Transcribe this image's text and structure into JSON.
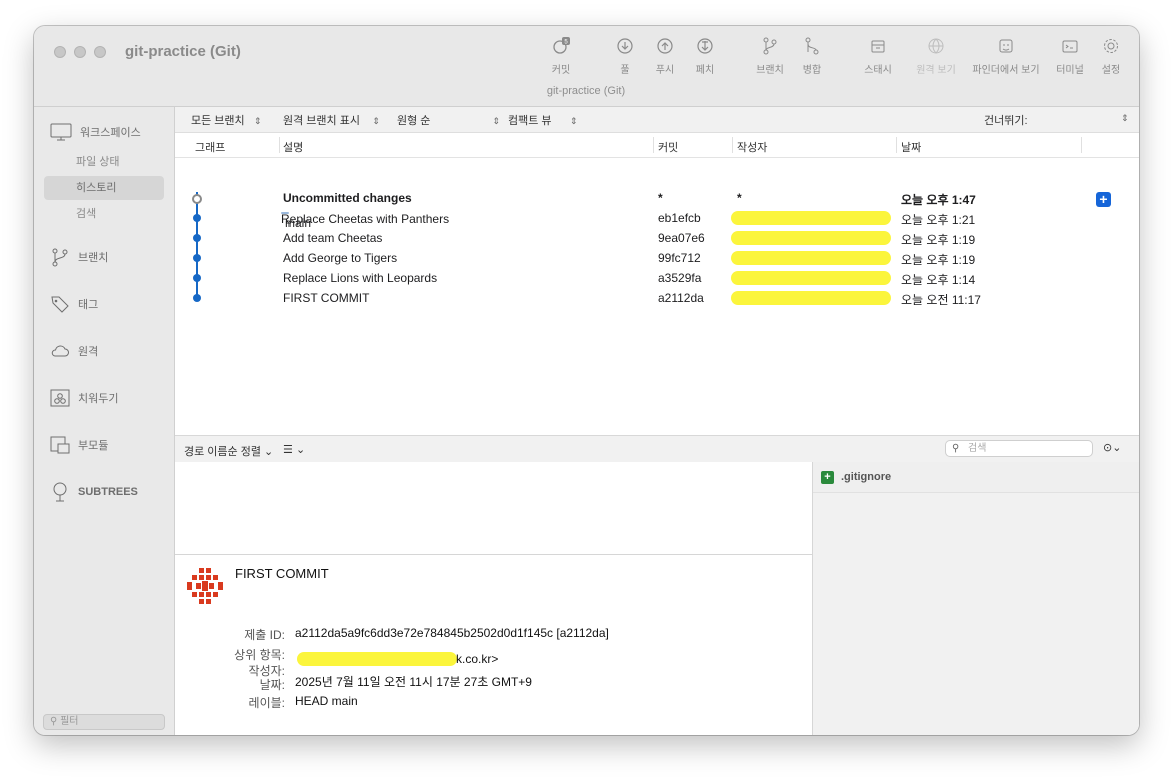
{
  "window": {
    "title": "git-practice (Git)",
    "subtitle": "git-practice (Git)"
  },
  "toolbar": [
    {
      "label": "커밋",
      "icon": "commit-icon",
      "badge": "5"
    },
    {
      "label": "풀",
      "icon": "pull-icon"
    },
    {
      "label": "푸시",
      "icon": "push-icon"
    },
    {
      "label": "페치",
      "icon": "fetch-icon"
    },
    {
      "label": "브랜치",
      "icon": "branch-icon"
    },
    {
      "label": "병합",
      "icon": "merge-icon"
    },
    {
      "label": "스태시",
      "icon": "stash-icon"
    },
    {
      "label": "원격 보기",
      "icon": "remote-view-icon",
      "disabled": true
    },
    {
      "label": "파인더에서 보기",
      "icon": "finder-icon"
    },
    {
      "label": "터미널",
      "icon": "terminal-icon"
    },
    {
      "label": "설정",
      "icon": "settings-icon"
    }
  ],
  "sidebar": {
    "workspace": "워크스페이스",
    "file_status": "파일 상태",
    "history": "히스토리",
    "search": "검색",
    "branches": "브랜치",
    "tags": "태그",
    "remotes": "원격",
    "stashes": "치워두기",
    "submodules": "부모듈",
    "subtrees": "SUBTREES",
    "filter_placeholder": "필터"
  },
  "filterbar": {
    "branches": "모든 브랜치",
    "remote": "원격 브랜치 표시",
    "order": "원형 순",
    "view": "컴팩트 뷰",
    "skip": "건너뛰기:"
  },
  "columns": {
    "graph": "그래프",
    "description": "설명",
    "commit": "커밋",
    "author": "작성자",
    "date": "날짜"
  },
  "commits": [
    {
      "description": "Uncommitted changes",
      "hash": "*",
      "author": "*",
      "date": "오늘 오후 1:47",
      "bold": true
    },
    {
      "branch": "main",
      "description": "Replace Cheetas with Panthers",
      "hash": "eb1efcb",
      "date": "오늘 오후 1:21"
    },
    {
      "description": "Add team Cheetas",
      "hash": "9ea07e6",
      "date": "오늘 오후 1:19"
    },
    {
      "description": "Add George to Tigers",
      "hash": "99fc712",
      "date": "오늘 오후 1:19"
    },
    {
      "description": "Replace Lions with Leopards",
      "hash": "a3529fa",
      "date": "오늘 오후 1:14"
    },
    {
      "description": "FIRST COMMIT",
      "hash": "a2112da",
      "date": "오늘 오전 11:17"
    }
  ],
  "midbar": {
    "sort": "경로 이름순 정렬",
    "search_placeholder": "검색"
  },
  "files": [
    {
      "name": ".gitignore",
      "status": "added"
    }
  ],
  "details": {
    "title": "FIRST COMMIT",
    "commit_id_label": "제출 ID:",
    "commit_id": "a2112da5a9fc6dd3e72e784845b2502d0d1f145c [a2112da]",
    "parent_label": "상위 항목:",
    "parent_value": "k.co.kr>",
    "author_label": "작성자:",
    "date_label": "날짜:",
    "date": "2025년 7월 11일 오전 11시 17분 27초 GMT+9",
    "labels_label": "레이블:",
    "labels": "HEAD main"
  },
  "colors": {
    "accent": "#1668c6",
    "redaction": "#fbf53c",
    "add": "#2a8a3c"
  }
}
